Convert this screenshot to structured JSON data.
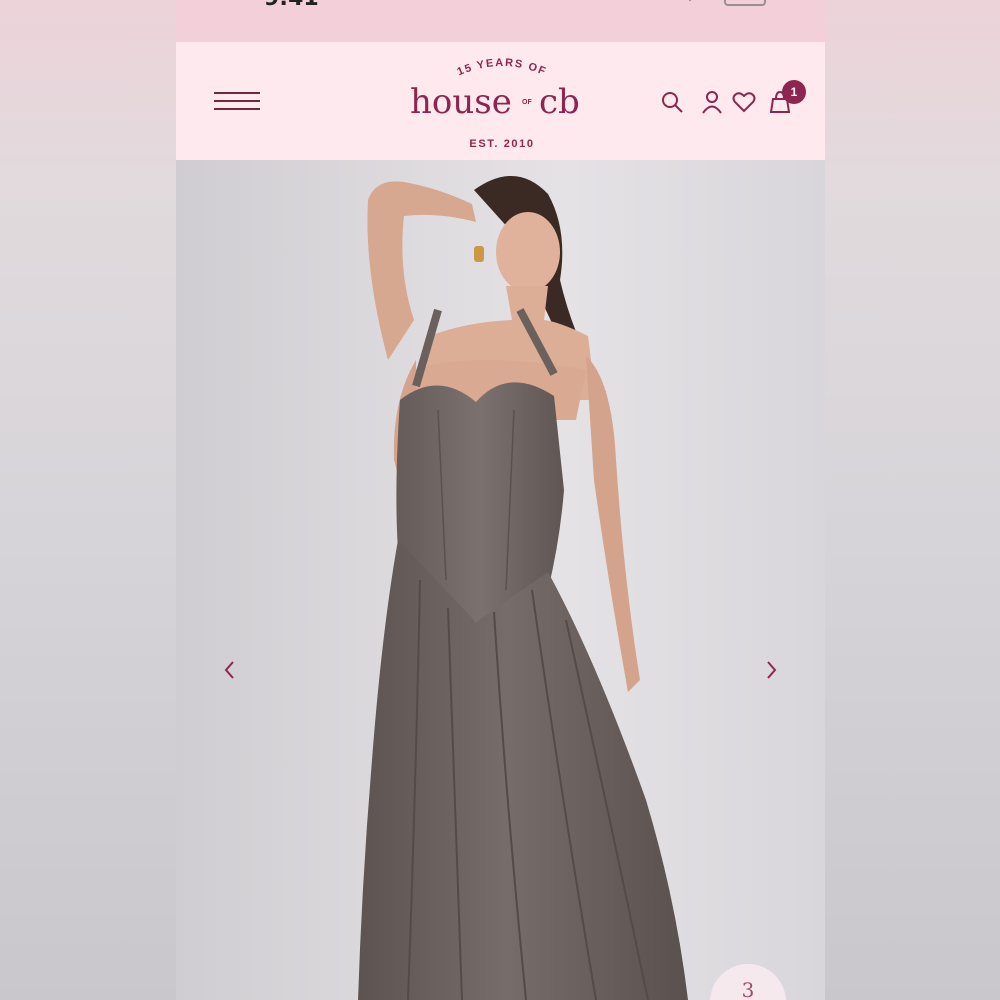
{
  "status_bar": {
    "time": "9:41",
    "battery_shown": true
  },
  "header": {
    "menu_icon": "hamburger-icon",
    "logo": {
      "arc_text": "15 YEARS OF",
      "wordmark_left": "house",
      "wordmark_of": "OF",
      "wordmark_right": "cb",
      "established": "EST. 2010"
    },
    "icons": [
      "search-icon",
      "account-icon",
      "heart-icon",
      "bag-icon"
    ],
    "cart_count": "1"
  },
  "gallery": {
    "prev_icon": "chevron-left-icon",
    "next_icon": "chevron-right-icon",
    "product_image_alt": "model wearing mocha halter corset midi dress"
  },
  "badge": {
    "text": "3"
  },
  "colors": {
    "brand": "#8e2550",
    "header_bg": "#fde9ee",
    "status_bg": "#f3cfd9",
    "dress": "#6f6562"
  }
}
